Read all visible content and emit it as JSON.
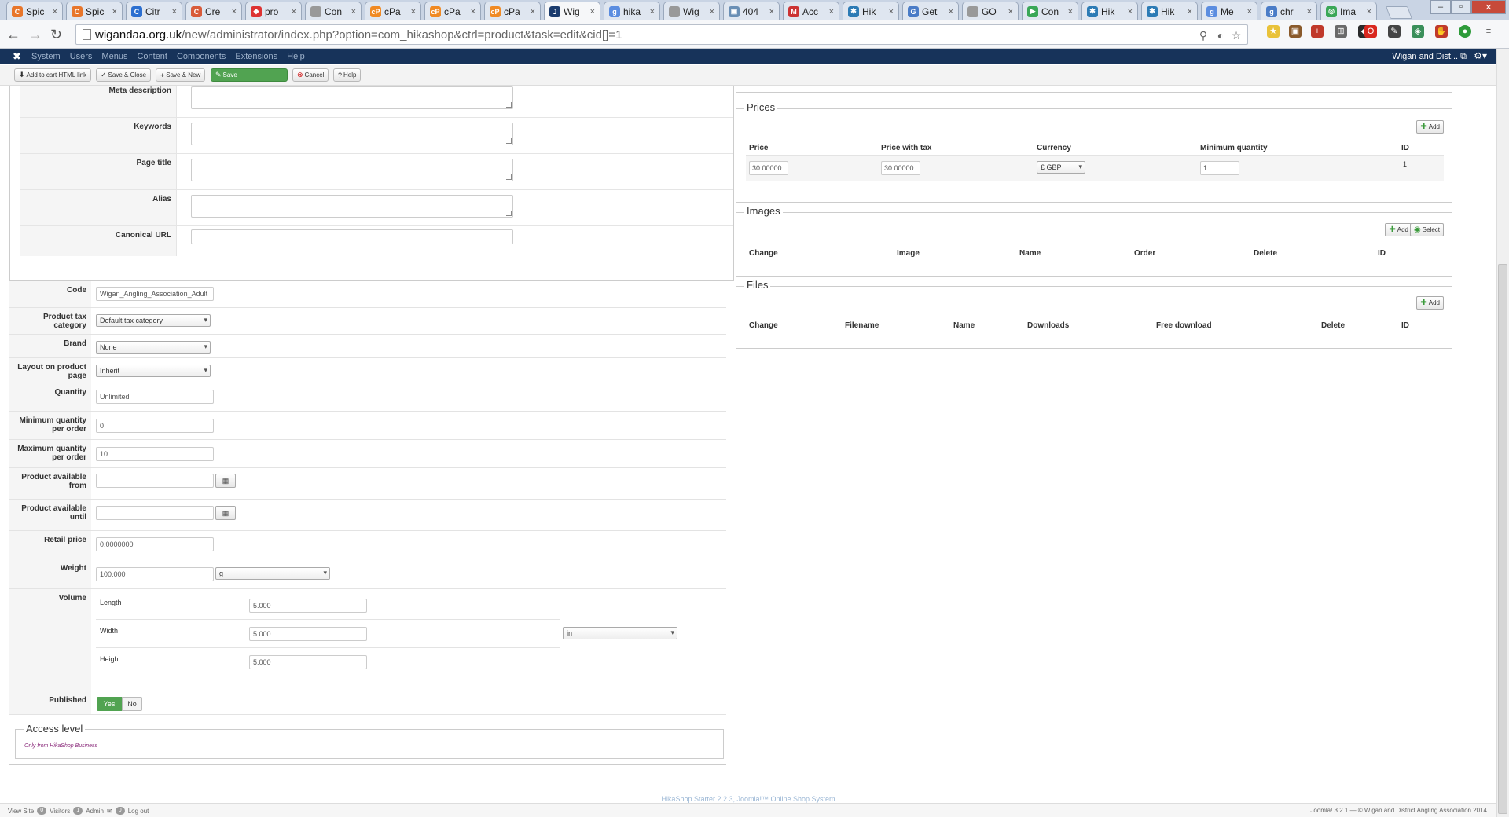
{
  "browser": {
    "tabs": [
      {
        "title": "Spic",
        "color": "#e8762b",
        "glyph": "C"
      },
      {
        "title": "Spic",
        "color": "#e8762b",
        "glyph": "C"
      },
      {
        "title": "Citr",
        "color": "#2b6fd0",
        "glyph": "C"
      },
      {
        "title": "Cre",
        "color": "#d85b3a",
        "glyph": "C"
      },
      {
        "title": "pro",
        "color": "#d33",
        "glyph": "◆"
      },
      {
        "title": "Con",
        "color": "#999",
        "glyph": ""
      },
      {
        "title": "cPa",
        "color": "#f08a24",
        "glyph": "cP"
      },
      {
        "title": "cPa",
        "color": "#f08a24",
        "glyph": "cP"
      },
      {
        "title": "cPa",
        "color": "#f08a24",
        "glyph": "cP"
      },
      {
        "title": "Wig",
        "color": "#1a3b6d",
        "glyph": "J",
        "active": true
      },
      {
        "title": "hika",
        "color": "#5b8de0",
        "glyph": "g"
      },
      {
        "title": "Wig",
        "color": "#999",
        "glyph": ""
      },
      {
        "title": "404",
        "color": "#6a8fb5",
        "glyph": "▣"
      },
      {
        "title": "Acc",
        "color": "#c33",
        "glyph": "M"
      },
      {
        "title": "Hik",
        "color": "#2c7bb5",
        "glyph": "✱"
      },
      {
        "title": "Get",
        "color": "#4a7cc7",
        "glyph": "G"
      },
      {
        "title": "GO",
        "color": "#999",
        "glyph": ""
      },
      {
        "title": "Con",
        "color": "#3aa757",
        "glyph": "▶"
      },
      {
        "title": "Hik",
        "color": "#2c7bb5",
        "glyph": "✱"
      },
      {
        "title": "Hik",
        "color": "#2c7bb5",
        "glyph": "✱"
      },
      {
        "title": "Me",
        "color": "#5b8de0",
        "glyph": "g"
      },
      {
        "title": "chr",
        "color": "#4a7cc7",
        "glyph": "g"
      },
      {
        "title": "Ima",
        "color": "#3aa757",
        "glyph": "◎"
      }
    ],
    "url_domain": "wigandaa.org.uk",
    "url_path": "/new/administrator/index.php?option=com_hikashop&ctrl=product&task=edit&cid[]=1"
  },
  "adminbar": {
    "logo": "✖",
    "menu": [
      "System",
      "Users",
      "Menus",
      "Content",
      "Components",
      "Extensions",
      "Help"
    ],
    "site": "Wigan and Dist... ⧉",
    "gear": "⚙▾"
  },
  "toolbar": {
    "add_cart_html": "Add to cart HTML link",
    "save_close": "Save & Close",
    "save_new": "Save & New",
    "save": "Save",
    "cancel": "Cancel",
    "help": "Help"
  },
  "seo": {
    "meta_description": "Meta description",
    "keywords": "Keywords",
    "page_title": "Page title",
    "alias": "Alias",
    "canonical_url": "Canonical URL"
  },
  "product": {
    "code_label": "Code",
    "code_value": "Wigan_Angling_Association_Adult",
    "tax_label": "Product tax category",
    "tax_value": "Default tax category",
    "brand_label": "Brand",
    "brand_value": "None",
    "layout_label": "Layout on product page",
    "layout_value": "Inherit",
    "quantity_label": "Quantity",
    "quantity_value": "Unlimited",
    "min_qty_label": "Minimum quantity per order",
    "min_qty_value": "0",
    "max_qty_label": "Maximum quantity per order",
    "max_qty_value": "10",
    "avail_from_label": "Product available from",
    "avail_until_label": "Product available until",
    "retail_label": "Retail price",
    "retail_value": "0.0000000",
    "weight_label": "Weight",
    "weight_value": "100.000",
    "weight_unit": "g",
    "volume_label": "Volume",
    "length_label": "Length",
    "length_value": "5.000",
    "width_label": "Width",
    "width_value": "5.000",
    "height_label": "Height",
    "height_value": "5.000",
    "volume_unit": "in",
    "published_label": "Published",
    "yes": "Yes",
    "no": "No",
    "access_legend": "Access level",
    "access_note": "Only from HikaShop Business"
  },
  "prices": {
    "legend": "Prices",
    "add": "Add",
    "headers": [
      "Price",
      "Price with tax",
      "Currency",
      "Minimum quantity",
      "ID"
    ],
    "row": {
      "price": "30.00000",
      "price_tax": "30.00000",
      "currency": "£ GBP",
      "min_qty": "1",
      "id": "1"
    }
  },
  "images": {
    "legend": "Images",
    "add": "Add",
    "select": "Select",
    "headers": [
      "Change",
      "Image",
      "Name",
      "Order",
      "Delete",
      "ID"
    ]
  },
  "files": {
    "legend": "Files",
    "add": "Add",
    "headers": [
      "Change",
      "Filename",
      "Name",
      "Downloads",
      "Free download",
      "Delete",
      "ID"
    ]
  },
  "footer": {
    "center": "HikaShop Starter 2.2.3, Joomla!™ Online Shop System",
    "view_site": "View Site",
    "visitors_count": "0",
    "visitors": "Visitors",
    "admin_count": "1",
    "admin": "Admin",
    "messages_count": "0",
    "logout": "Log out",
    "right": "Joomla! 3.2.1 — © Wigan and District Angling Association 2014"
  }
}
